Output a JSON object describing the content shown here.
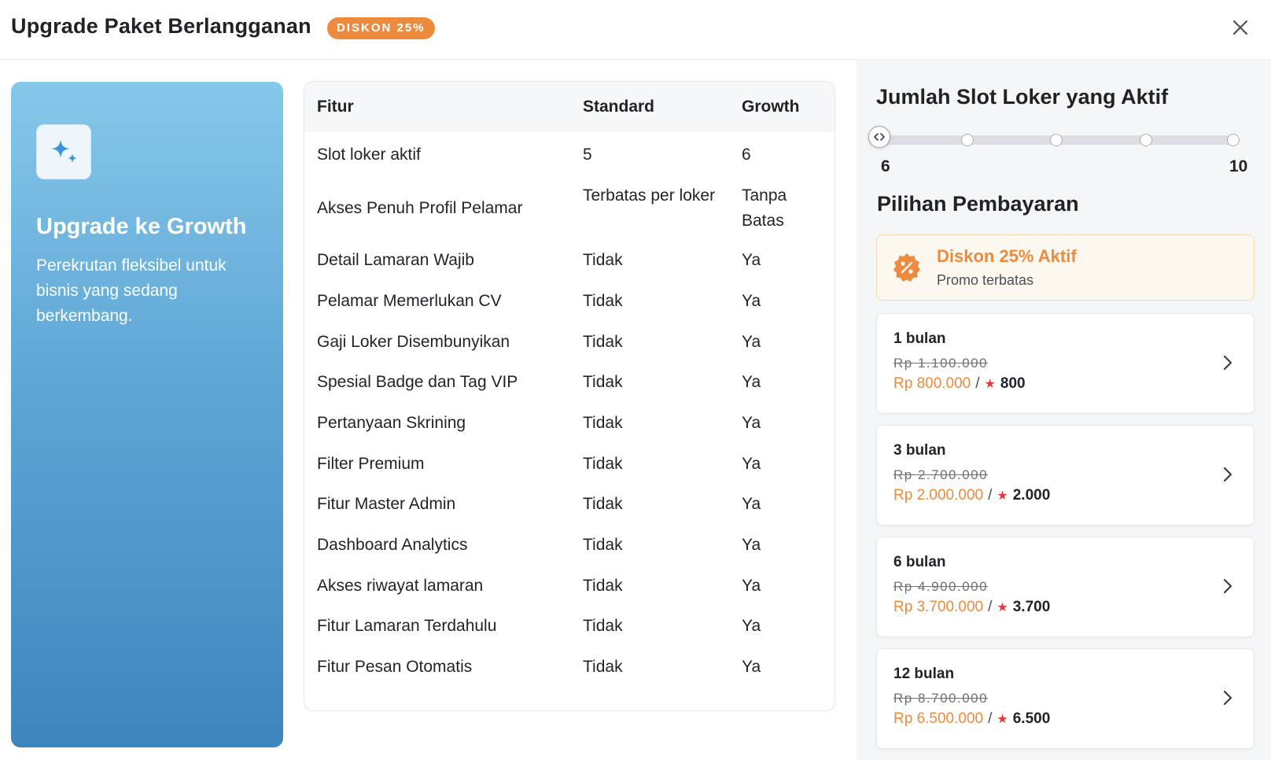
{
  "header": {
    "title": "Upgrade Paket Berlangganan",
    "badge": "DISKON 25%"
  },
  "promo": {
    "icon": "sparkles-icon",
    "title": "Upgrade ke Growth",
    "description": "Perekrutan fleksibel untuk bisnis yang sedang berkembang."
  },
  "comparison": {
    "headers": [
      "Fitur",
      "Standard",
      "Growth"
    ],
    "rows": [
      {
        "feature": "Slot loker aktif",
        "standard": "5",
        "growth": "6"
      },
      {
        "feature": "Akses Penuh Profil Pelamar",
        "standard": "Terbatas per loker",
        "growth": "Tanpa Batas"
      },
      {
        "feature": "Detail Lamaran Wajib",
        "standard": "Tidak",
        "growth": "Ya"
      },
      {
        "feature": "Pelamar Memerlukan CV",
        "standard": "Tidak",
        "growth": "Ya"
      },
      {
        "feature": "Gaji Loker Disembunyikan",
        "standard": "Tidak",
        "growth": "Ya"
      },
      {
        "feature": "Spesial Badge dan Tag VIP",
        "standard": "Tidak",
        "growth": "Ya"
      },
      {
        "feature": "Pertanyaan Skrining",
        "standard": "Tidak",
        "growth": "Ya"
      },
      {
        "feature": "Filter Premium",
        "standard": "Tidak",
        "growth": "Ya"
      },
      {
        "feature": "Fitur Master Admin",
        "standard": "Tidak",
        "growth": "Ya"
      },
      {
        "feature": "Dashboard Analytics",
        "standard": "Tidak",
        "growth": "Ya"
      },
      {
        "feature": "Akses riwayat lamaran",
        "standard": "Tidak",
        "growth": "Ya"
      },
      {
        "feature": "Fitur Lamaran Terdahulu",
        "standard": "Tidak",
        "growth": "Ya"
      },
      {
        "feature": "Fitur Pesan Otomatis",
        "standard": "Tidak",
        "growth": "Ya"
      }
    ]
  },
  "slots": {
    "title": "Jumlah Slot Loker yang Aktif",
    "min_label": "6",
    "max_label": "10",
    "selected": 6,
    "min": 6,
    "max": 10
  },
  "payment": {
    "title": "Pilihan Pembayaran",
    "promo_title": "Diskon 25% Aktif",
    "promo_subtitle": "Promo terbatas",
    "plans": [
      {
        "name": "1 bulan",
        "old_price": "Rp 1.100.000",
        "price": "Rp 800.000",
        "separator": "/",
        "points": "800"
      },
      {
        "name": "3 bulan",
        "old_price": "Rp 2.700.000",
        "price": "Rp 2.000.000",
        "separator": "/",
        "points": "2.000"
      },
      {
        "name": "6 bulan",
        "old_price": "Rp 4.900.000",
        "price": "Rp 3.700.000",
        "separator": "/",
        "points": "3.700"
      },
      {
        "name": "12 bulan",
        "old_price": "Rp 8.700.000",
        "price": "Rp 6.500.000",
        "separator": "/",
        "points": "6.500"
      }
    ]
  },
  "colors": {
    "accent": "#ec8a3d",
    "star": "#e23b3b",
    "promo_gradient_top": "#86c8ea",
    "promo_gradient_bottom": "#3f85bd"
  }
}
